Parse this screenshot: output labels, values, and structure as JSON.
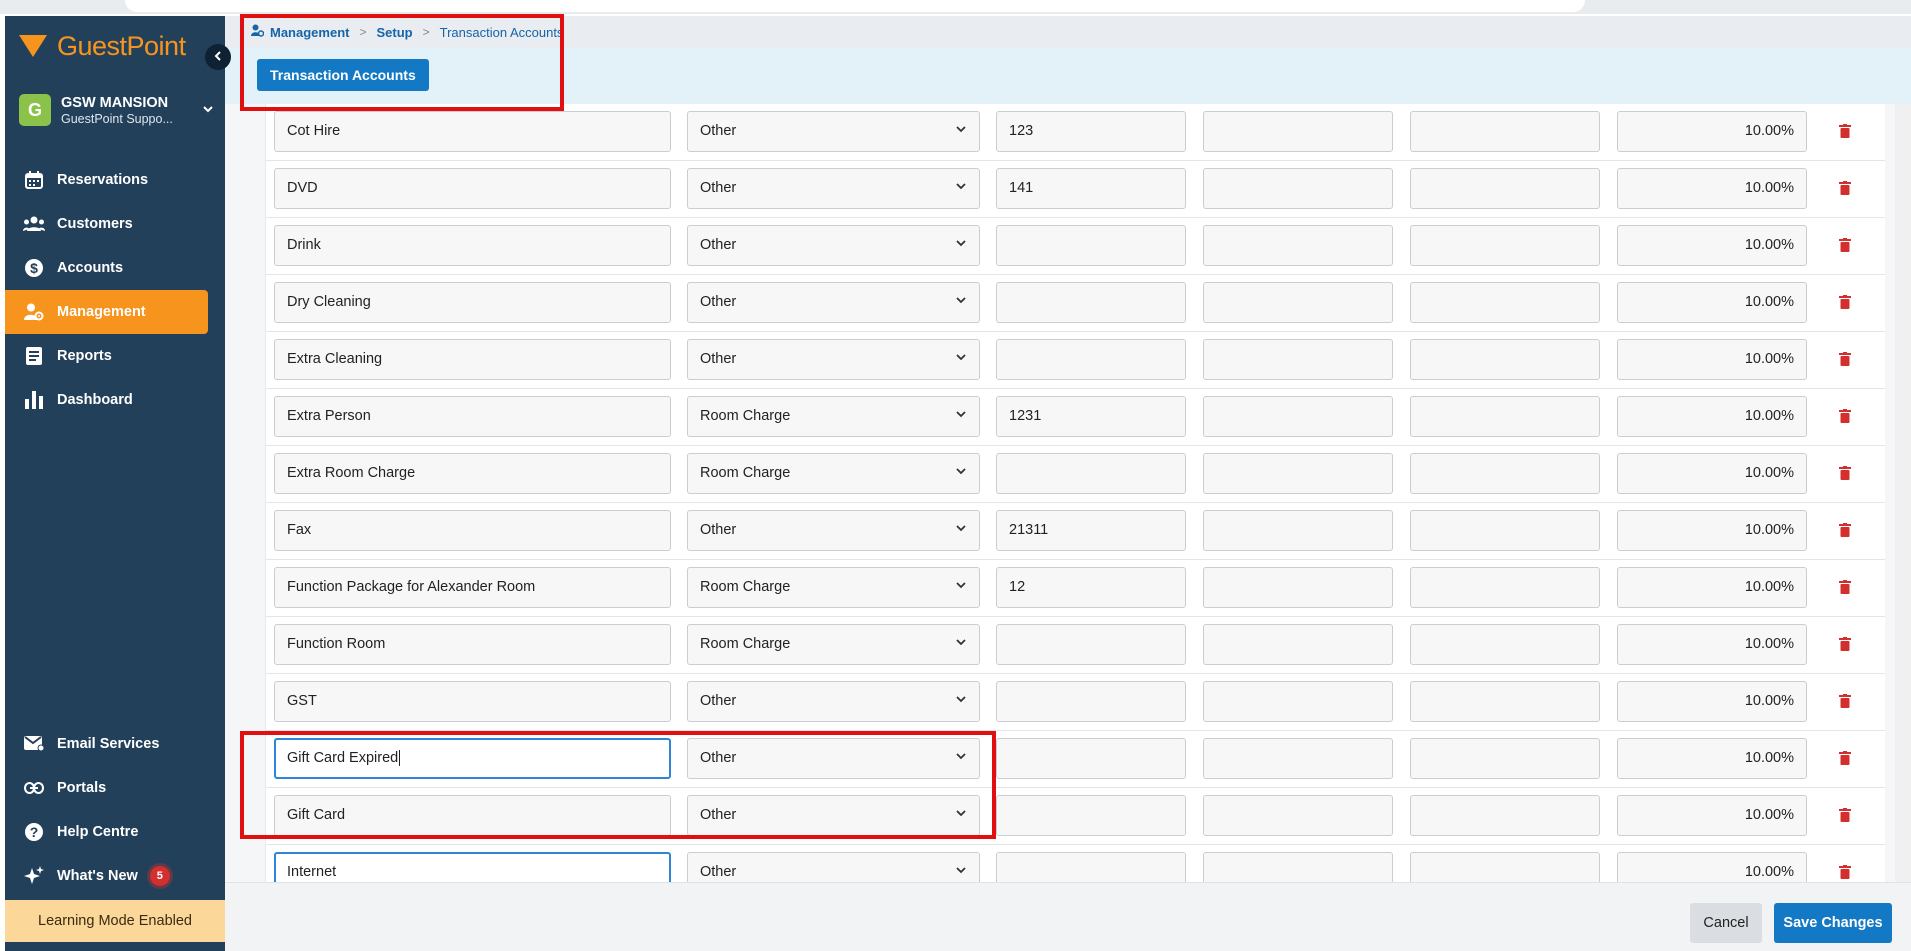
{
  "app": {
    "logo_text": "GuestPoint",
    "brand_color": "#f7941d",
    "sidebar_color": "#23405b"
  },
  "property": {
    "avatar_letter": "G",
    "name": "GSW MANSION",
    "subtitle": "GuestPoint Suppo..."
  },
  "nav": {
    "items": [
      {
        "label": "Reservations",
        "icon": "calendar-icon"
      },
      {
        "label": "Customers",
        "icon": "users-icon"
      },
      {
        "label": "Accounts",
        "icon": "dollar-icon"
      },
      {
        "label": "Management",
        "icon": "management-icon",
        "active": true
      },
      {
        "label": "Reports",
        "icon": "report-icon"
      },
      {
        "label": "Dashboard",
        "icon": "bar-chart-icon"
      }
    ],
    "bottom_items": [
      {
        "label": "Email Services",
        "icon": "email-icon"
      },
      {
        "label": "Portals",
        "icon": "link-icon"
      },
      {
        "label": "Help Centre",
        "icon": "help-icon"
      },
      {
        "label": "What's New",
        "icon": "sparkle-icon",
        "badge": "5"
      }
    ],
    "learning_mode": "Learning Mode Enabled"
  },
  "breadcrumb": {
    "items": [
      "Management",
      "Setup",
      "Transaction Accounts"
    ]
  },
  "tab": {
    "label": "Transaction Accounts"
  },
  "rows": [
    {
      "name": "Cot Hire",
      "type": "Other",
      "code": "123",
      "e1": "",
      "e2": "",
      "pct": "10.00%"
    },
    {
      "name": "DVD",
      "type": "Other",
      "code": "141",
      "e1": "",
      "e2": "",
      "pct": "10.00%"
    },
    {
      "name": "Drink",
      "type": "Other",
      "code": "",
      "e1": "",
      "e2": "",
      "pct": "10.00%"
    },
    {
      "name": "Dry Cleaning",
      "type": "Other",
      "code": "",
      "e1": "",
      "e2": "",
      "pct": "10.00%"
    },
    {
      "name": "Extra Cleaning",
      "type": "Other",
      "code": "",
      "e1": "",
      "e2": "",
      "pct": "10.00%"
    },
    {
      "name": "Extra Person",
      "type": "Room Charge",
      "code": "1231",
      "e1": "",
      "e2": "",
      "pct": "10.00%"
    },
    {
      "name": "Extra Room Charge",
      "type": "Room Charge",
      "code": "",
      "e1": "",
      "e2": "",
      "pct": "10.00%"
    },
    {
      "name": "Fax",
      "type": "Other",
      "code": "21311",
      "e1": "",
      "e2": "",
      "pct": "10.00%"
    },
    {
      "name": "Function Package for Alexander Room",
      "type": "Room Charge",
      "code": "12",
      "e1": "",
      "e2": "",
      "pct": "10.00%"
    },
    {
      "name": "Function Room",
      "type": "Room Charge",
      "code": "",
      "e1": "",
      "e2": "",
      "pct": "10.00%"
    },
    {
      "name": "GST",
      "type": "Other",
      "code": "",
      "e1": "",
      "e2": "",
      "pct": "10.00%"
    },
    {
      "name": "Gift Card Expired",
      "type": "Other",
      "code": "",
      "e1": "",
      "e2": "",
      "pct": "10.00%",
      "focused": true
    },
    {
      "name": "Gift Card",
      "type": "Other",
      "code": "",
      "e1": "",
      "e2": "",
      "pct": "10.00%"
    },
    {
      "name": "Internet",
      "type": "Other",
      "code": "",
      "e1": "",
      "e2": "",
      "pct": "10.00%",
      "focused": true
    }
  ],
  "footer": {
    "cancel_label": "Cancel",
    "save_label": "Save Changes"
  },
  "colors": {
    "primary_button": "#1479c4",
    "delete_icon": "#d32f2f",
    "annotation": "#e01010"
  }
}
